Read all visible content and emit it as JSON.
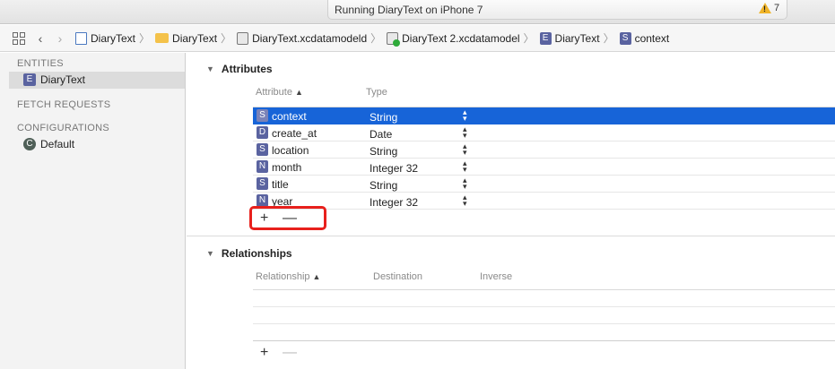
{
  "activity": {
    "status": "Running DiaryText on iPhone 7",
    "warning_count": "7"
  },
  "breadcrumbs": [
    {
      "label": "DiaryText",
      "icon": "project-doc-icon"
    },
    {
      "label": "DiaryText",
      "icon": "folder-icon"
    },
    {
      "label": "DiaryText.xcdatamodeld",
      "icon": "datamodel-bundle-icon"
    },
    {
      "label": "DiaryText 2.xcdatamodel",
      "icon": "datamodel-version-icon"
    },
    {
      "label": "DiaryText",
      "icon": "entity-icon",
      "badge": "E"
    },
    {
      "label": "context",
      "icon": "attribute-icon",
      "badge": "S"
    }
  ],
  "sidebar": {
    "entities_header": "ENTITIES",
    "entity": {
      "badge": "E",
      "label": "DiaryText"
    },
    "fetch_header": "FETCH REQUESTS",
    "config_header": "CONFIGURATIONS",
    "config": {
      "badge": "C",
      "label": "Default"
    }
  },
  "attributes": {
    "title": "Attributes",
    "col_attribute": "Attribute",
    "col_type": "Type",
    "rows": [
      {
        "badge": "S",
        "name": "context",
        "type": "String"
      },
      {
        "badge": "D",
        "name": "create_at",
        "type": "Date"
      },
      {
        "badge": "S",
        "name": "location",
        "type": "String"
      },
      {
        "badge": "N",
        "name": "month",
        "type": "Integer 32"
      },
      {
        "badge": "S",
        "name": "title",
        "type": "String"
      },
      {
        "badge": "N",
        "name": "year",
        "type": "Integer 32"
      }
    ],
    "add": "+",
    "remove": "—"
  },
  "relationships": {
    "title": "Relationships",
    "col_relationship": "Relationship",
    "col_destination": "Destination",
    "col_inverse": "Inverse",
    "add": "+",
    "remove": "—"
  },
  "colors": {
    "selection": "#1764d8",
    "highlight_box": "#e8201c",
    "warning": "#f0b428"
  }
}
